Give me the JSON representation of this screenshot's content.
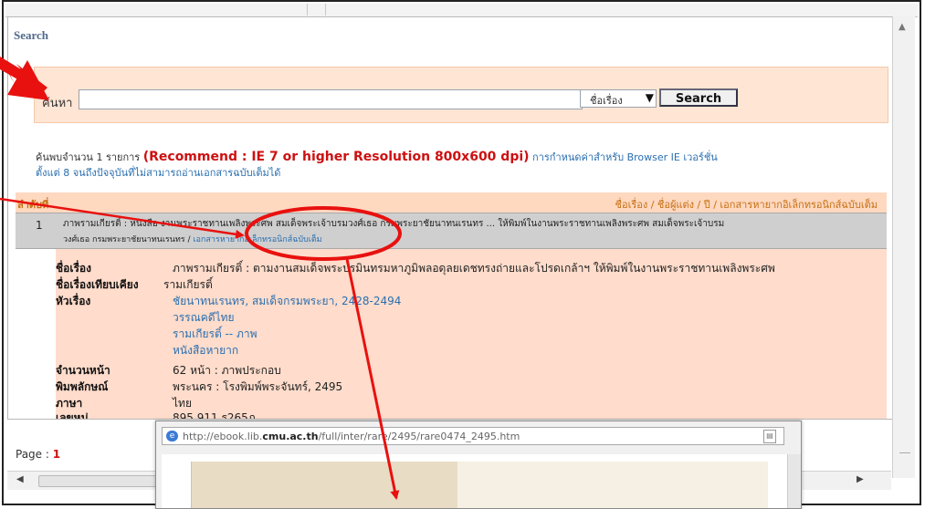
{
  "search": {
    "title": "Search",
    "label": "ค้นหา",
    "input_value": "",
    "select_value": "ชื่อเรื่อง",
    "button_label": "Search"
  },
  "found": {
    "prefix": "ค้นพบจำนวน  1 รายการ",
    "recommend": "(Recommend : IE 7 or higher Resolution 800x600 dpi)",
    "note_blue": "การกำหนดค่าสำหรับ  Browser IE เวอร์ชั่น",
    "line2": "ตั้งแต่  8 จนถึงปัจจุบันที่ไม่สามารถอ่านเอกสารฉบับเต็มได้"
  },
  "result_header": {
    "left": "ลำดับที่",
    "right": "ชื่อเรื่อง / ชื่อผู้แต่ง / ปี / เอกสารหายากอิเล็กทรอนิกส์ฉบับเต็ม"
  },
  "result_row": {
    "number": "1",
    "line1": "ภาพรามเกียรติ์ : หนังสือ งานพระราชทานเพลิงพระศพ สมเด็จพระเจ้าบรมวงศ์เธอ กรมพระยาชัยนาทนเรนทร ... ให้พิมพ์ในงานพระราชทานเพลิงพระศพ สมเด็จพระเจ้าบรม",
    "line2_text": "วงศ์เธอ กรมพระยาชัยนาทนเรนทร /",
    "line2_link": "เอกสารหายากอิเล็กทรอนิกส์ฉบับเต็ม"
  },
  "details": [
    {
      "key": "ชื่อเรื่อง",
      "value": "ภาพรามเกียรติ์ : ตามงานสมเด็จพระปรมินทรมหาภูมิพลอดุลยเดชทรงถ่ายและโปรดเกล้าฯ  ให้พิมพ์ในงานพระราชทานเพลิงพระศพ",
      "blue": false
    },
    {
      "key": "ชื่อเรื่องเทียบเคียง",
      "value": "รามเกียรติ์",
      "blue": false
    },
    {
      "key": "หัวเรื่อง",
      "value": "ชัยนาทนเรนทร, สมเด็จกรมพระยา, 2428-2494",
      "blue": true
    },
    {
      "key": "",
      "value": "วรรณคดีไทย",
      "blue": true
    },
    {
      "key": "",
      "value": "รามเกียรติ์  -- ภาพ",
      "blue": true
    },
    {
      "key": "",
      "value": "หนังสือหายาก",
      "blue": true
    },
    {
      "key": "จำนวนหน้า",
      "value": "62 หน้า  : ภาพประกอบ",
      "blue": false
    },
    {
      "key": "พิมพลักษณ์",
      "value": "พระนคร  : โรงพิมพ์พระจันทร์, 2495",
      "blue": false
    },
    {
      "key": "ภาษา",
      "value": "ไทย",
      "blue": false
    },
    {
      "key": "เลขหมู่",
      "value": "895.911 ร265ภ",
      "blue": false
    }
  ],
  "pagination": {
    "label": "Page :",
    "current": "1"
  },
  "popup": {
    "url_prefix": "http://ebook.lib.",
    "url_domain": "cmu.ac.th",
    "url_suffix": "/full/inter/rare/2495/rare0474_2495.htm"
  },
  "colors": {
    "arrow_red": "#e8110f",
    "panel_peach": "#ffe5d4",
    "link_blue": "#2a6fb0",
    "recommend_red": "#cc1111"
  }
}
